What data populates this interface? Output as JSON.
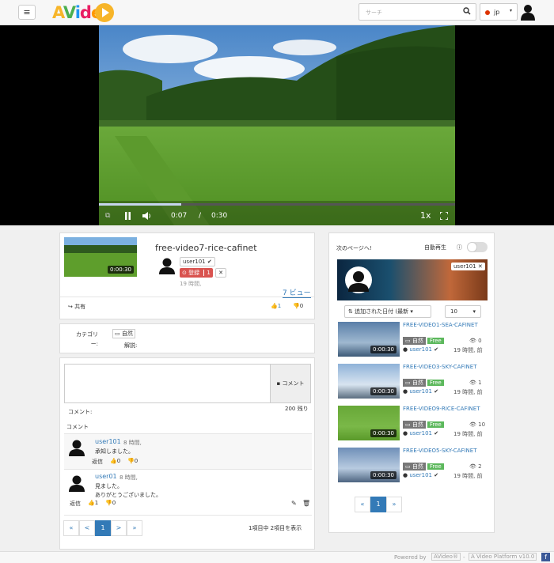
{
  "header": {
    "menu_icon": "≡",
    "logo_text": "AVideo",
    "search_placeholder": "サーチ",
    "search_icon": "search-icon",
    "lang_label": "jp",
    "lang_caret": "▾"
  },
  "player": {
    "current_time": "0:07",
    "separator": "/",
    "duration": "0:30",
    "speed": "1x",
    "progress_fraction": 0.23
  },
  "video": {
    "title": "free-video7-rice-cafinet",
    "thumb_duration": "0:00:30",
    "uploader": "user101",
    "subscribe_label": "登録",
    "subscribe_count": "1",
    "uploaded_ago": "19 時間,",
    "views": "7 ビュー",
    "share_label": "共有",
    "likes": "1",
    "dislikes": "0"
  },
  "meta": {
    "category_label": "カテゴリー:",
    "category_value": "自然",
    "description_label": "解説:"
  },
  "comments": {
    "input_button": "コメント",
    "chars_left": "200 残り",
    "comment_label": "コメント:",
    "section_title": "コメント",
    "items": [
      {
        "user": "user101",
        "time": "8 時間,",
        "text": "承知しました。",
        "reply": "返信",
        "likes": "0",
        "dislikes": "0"
      },
      {
        "user": "user01",
        "time": "8 時間,",
        "text": "見ました。",
        "text2": "ありがとうございました。",
        "reply": "返信",
        "likes": "1",
        "dislikes": "0"
      }
    ],
    "pagination": [
      "«",
      "<",
      "1",
      ">",
      "»"
    ],
    "page_summary": "1項目中 2項目を表示"
  },
  "sidebar": {
    "next_label": "次のページへ!",
    "autoplay_label": "自動再生",
    "channel_tag": "user101",
    "sort_label": "追加された日付 (最新",
    "count_value": "10",
    "videos": [
      {
        "title": "FREE-VIDEO1-SEA-CAFINET",
        "category": "自然",
        "badge": "Free",
        "views": "0",
        "user": "user101",
        "ago": "19 時間, 前",
        "duration": "0:00:30"
      },
      {
        "title": "FREE-VIDEO3-SKY-CAFINET",
        "category": "自然",
        "badge": "Free",
        "views": "1",
        "user": "user101",
        "ago": "19 時間, 前",
        "duration": "0:00:30"
      },
      {
        "title": "FREE-VIDEO9-RICE-CAFINET",
        "category": "自然",
        "badge": "Free",
        "views": "10",
        "user": "user101",
        "ago": "19 時間, 前",
        "duration": "0:00:30"
      },
      {
        "title": "FREE-VIDEO5-SKY-CAFINET",
        "category": "自然",
        "badge": "Free",
        "views": "2",
        "user": "user101",
        "ago": "19 時間, 前",
        "duration": "0:00:30"
      }
    ],
    "pagination": [
      "«",
      "1",
      "»"
    ]
  },
  "footer": {
    "powered_by": "Powered by",
    "brand": "AVideo®",
    "dash": "-",
    "platform": "A Video Platform v10.0"
  },
  "colors": {
    "accent": "#337ab7",
    "subscribe": "#d9534f",
    "free": "#5cb85c"
  }
}
